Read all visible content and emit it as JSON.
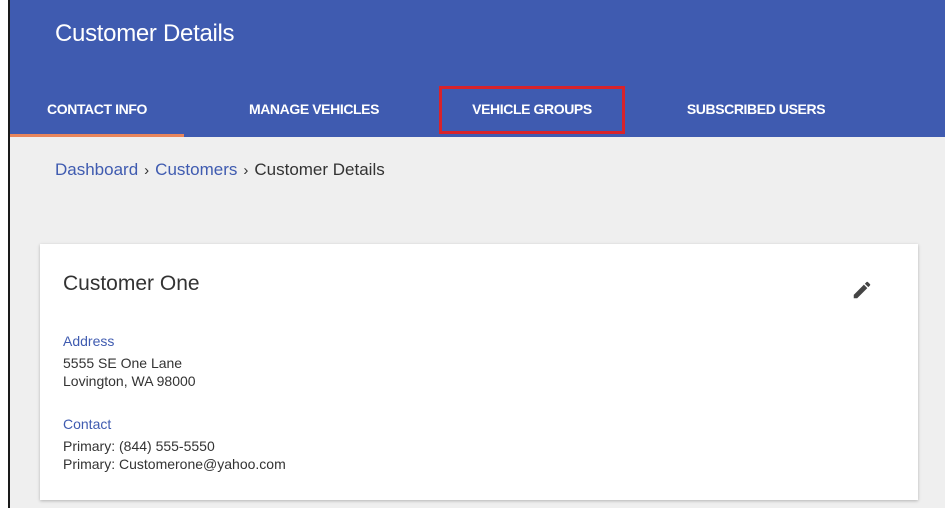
{
  "header": {
    "title": "Customer Details",
    "tabs": [
      {
        "label": "CONTACT INFO"
      },
      {
        "label": "MANAGE VEHICLES"
      },
      {
        "label": "VEHICLE GROUPS"
      },
      {
        "label": "SUBSCRIBED USERS"
      }
    ]
  },
  "breadcrumb": {
    "items": [
      "Dashboard",
      "Customers",
      "Customer Details"
    ],
    "separator": "›"
  },
  "card": {
    "title": "Customer One",
    "address_label": "Address",
    "address_line1": "5555 SE One Lane",
    "address_line2": "Lovington, WA 98000",
    "contact_label": "Contact",
    "contact_line1": "Primary: (844) 555-5550",
    "contact_line2": "Primary: Customerone@yahoo.com",
    "edit_icon": "pencil-icon"
  },
  "colors": {
    "header_bg": "#3f5bb0",
    "active_underline": "#e8855b",
    "highlight_box": "#d8232a",
    "link": "#3f5bb0"
  }
}
